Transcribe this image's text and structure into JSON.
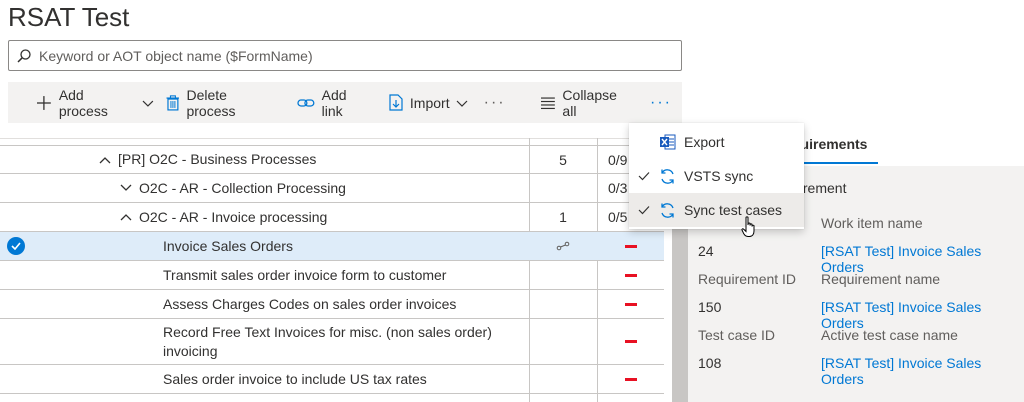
{
  "page": {
    "title": "RSAT Test"
  },
  "search": {
    "placeholder": "Keyword or AOT object name ($FormName)"
  },
  "toolbar": {
    "add_process": "Add process",
    "delete_process": "Delete process",
    "add_link": "Add link",
    "import": "Import",
    "more_1": "···",
    "collapse_all": "Collapse all",
    "more_2": "···"
  },
  "menu": {
    "items": [
      {
        "label": "Export",
        "icon": "excel-icon",
        "checked": false
      },
      {
        "label": "VSTS sync",
        "icon": "sync-icon",
        "checked": true
      },
      {
        "label": "Sync test cases",
        "icon": "sync-icon",
        "checked": true
      }
    ]
  },
  "tree": {
    "rows": [
      {
        "label": "[PR] O2C - Business Processes",
        "expand": "collapse",
        "col1": "5",
        "col2": "0/9"
      },
      {
        "label": "O2C - AR - Collection Processing",
        "expand": "expand",
        "col1": "",
        "col2": "0/3"
      },
      {
        "label": "O2C - AR - Invoice processing",
        "expand": "collapse",
        "col1": "1",
        "col2": "0/5"
      },
      {
        "label": "Invoice Sales Orders",
        "selected": true,
        "col1_icon": "link-icon",
        "col2_status": "missing"
      },
      {
        "label": "Transmit sales order invoice form to customer",
        "col2_status": "missing"
      },
      {
        "label": "Assess Charges Codes on sales order invoices",
        "col2_status": "missing"
      },
      {
        "label": "Record Free Text Invoices for misc. (non sales order) invoicing",
        "col2_status": "missing"
      },
      {
        "label": "Sales order invoice to include US tax rates",
        "col2_status": "missing"
      }
    ]
  },
  "details": {
    "tab_label": "quirements",
    "section_header": "uirement",
    "work_item_header": "Work item name",
    "work_item_id": "24",
    "work_item_name": "[RSAT Test] Invoice Sales Orders",
    "requirement_id_label": "Requirement ID",
    "requirement_name_label": "Requirement name",
    "requirement_id": "150",
    "requirement_name": "[RSAT Test] Invoice Sales Orders",
    "test_case_id_label": "Test case ID",
    "active_test_case_label": "Active test case name",
    "test_case_id": "108",
    "test_case_name": "[RSAT Test] Invoice Sales Orders"
  },
  "colors": {
    "accent": "#0078d4",
    "status_missing": "#e81123",
    "selected_row": "#deecf9"
  }
}
